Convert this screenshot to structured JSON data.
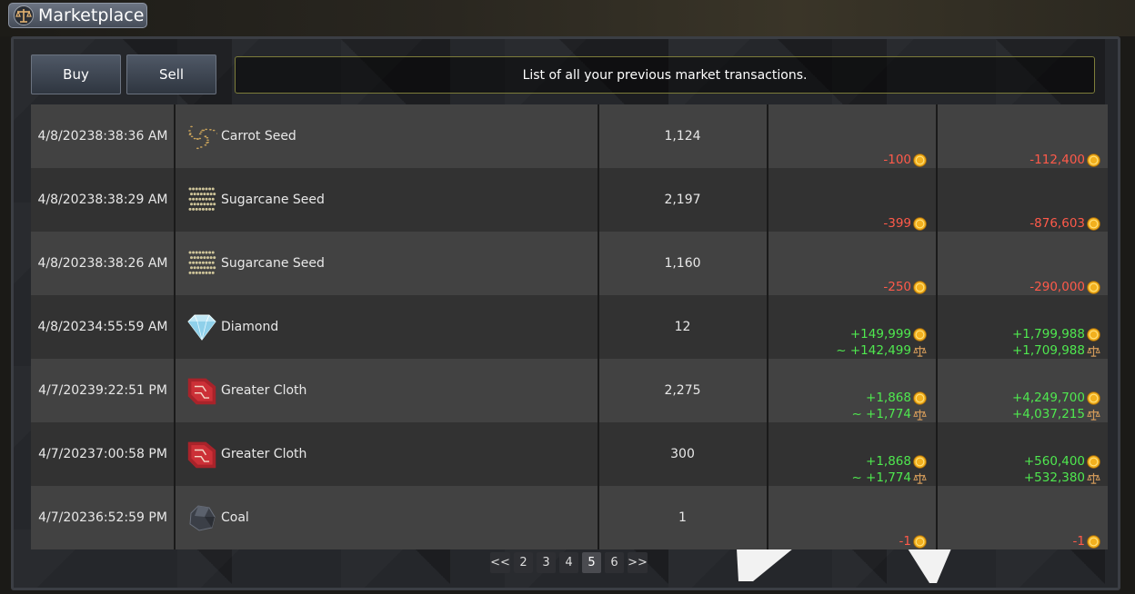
{
  "window": {
    "title": "Marketplace"
  },
  "tabs": {
    "buy_label": "Buy",
    "sell_label": "Sell"
  },
  "info_text": "List of all your previous market transactions.",
  "rows": [
    {
      "date": "4/8/20238:38:36 AM",
      "item": "Carrot Seed",
      "icon": "carrot-seed-icon",
      "qty": "1,124",
      "price": "-100",
      "price_kind": "neg",
      "price_net": "",
      "total": "-112,400",
      "total_kind": "neg",
      "total_net": ""
    },
    {
      "date": "4/8/20238:38:29 AM",
      "item": "Sugarcane Seed",
      "icon": "sugarcane-seed-icon",
      "qty": "2,197",
      "price": "-399",
      "price_kind": "neg",
      "price_net": "",
      "total": "-876,603",
      "total_kind": "neg",
      "total_net": ""
    },
    {
      "date": "4/8/20238:38:26 AM",
      "item": "Sugarcane Seed",
      "icon": "sugarcane-seed-icon",
      "qty": "1,160",
      "price": "-250",
      "price_kind": "neg",
      "price_net": "",
      "total": "-290,000",
      "total_kind": "neg",
      "total_net": ""
    },
    {
      "date": "4/8/20234:55:59 AM",
      "item": "Diamond",
      "icon": "diamond-icon",
      "qty": "12",
      "price": "+149,999",
      "price_kind": "pos",
      "price_net": "~ +142,499",
      "total": "+1,799,988",
      "total_kind": "pos",
      "total_net": "+1,709,988"
    },
    {
      "date": "4/7/20239:22:51 PM",
      "item": "Greater Cloth",
      "icon": "greater-cloth-icon",
      "qty": "2,275",
      "price": "+1,868",
      "price_kind": "pos",
      "price_net": "~ +1,774",
      "total": "+4,249,700",
      "total_kind": "pos",
      "total_net": "+4,037,215"
    },
    {
      "date": "4/7/20237:00:58 PM",
      "item": "Greater Cloth",
      "icon": "greater-cloth-icon",
      "qty": "300",
      "price": "+1,868",
      "price_kind": "pos",
      "price_net": "~ +1,774",
      "total": "+560,400",
      "total_kind": "pos",
      "total_net": "+532,380"
    },
    {
      "date": "4/7/20236:52:59 PM",
      "item": "Coal",
      "icon": "coal-icon",
      "qty": "1",
      "price": "-1",
      "price_kind": "neg",
      "price_net": "",
      "total": "-1",
      "total_kind": "neg",
      "total_net": ""
    }
  ],
  "pager": {
    "prev_label": "<<",
    "pages": [
      "2",
      "3",
      "4",
      "5",
      "6"
    ],
    "current": "5",
    "next_label": ">>"
  },
  "colors": {
    "negative": "#ff5a4a",
    "positive": "#4fe84f",
    "coin": "#f2b01e"
  }
}
